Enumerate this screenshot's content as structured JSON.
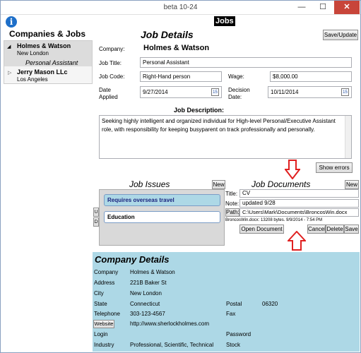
{
  "window": {
    "title": "beta 10-24",
    "min": "—",
    "max": "☐",
    "close": "✕"
  },
  "header": {
    "jobs_title": "Jobs",
    "info_icon": "i"
  },
  "companies": {
    "title": "Companies & Jobs",
    "items": [
      {
        "name": "Holmes & Watson",
        "city": "New London",
        "job": "Personal Assistant"
      },
      {
        "name": "Jerry Mason LLc",
        "city": "Los Angeles"
      }
    ]
  },
  "job_details": {
    "title": "Job Details",
    "save_label": "Save/Update",
    "company_label": "Company:",
    "company_value": "Holmes & Watson",
    "job_title_label": "Job Title:",
    "job_title_value": "Personal Assistant",
    "job_code_label": "Job Code:",
    "job_code_value": "Right-Hand person",
    "wage_label": "Wage:",
    "wage_value": "$8,000.00",
    "date_applied_label_1": "Date",
    "date_applied_label_2": "Applied",
    "date_applied_value": "9/27/2014",
    "decision_label_1": "Decision",
    "decision_label_2": "Date:",
    "decision_value": "10/11/2014",
    "calendar_icon_text": "15",
    "description_label": "Job Description:",
    "description": "Seeking highly intelligent and organized individual for High-level Personal/Executive Assistant role, with responsibility for keeping busyparent on track professionally and personally.",
    "show_errors_label": "Show errors"
  },
  "job_issues": {
    "title": "Job Issues",
    "new_label": "New",
    "up_label": "U",
    "down_label": "D",
    "items": [
      "Requires overseas travel",
      "Education"
    ]
  },
  "job_documents": {
    "title": "Job Documents",
    "new_label": "New",
    "title_label": "Title:",
    "title_value": "CV",
    "note_label": "Note:",
    "note_value": "updated 9/28",
    "path_label": "Path:",
    "path_value": "C:\\Users\\Mark\\Documents\\BroncosWin.docx",
    "file_info": "BroncosWin.docx: 13208 bytes. 9/9/2014 - 7:54 PM",
    "open_label": "Open Document",
    "cancel_label": "Cancel",
    "delete_label": "Delete",
    "save_label": "Save"
  },
  "company_details": {
    "title": "Company Details",
    "company_label": "Company",
    "company_value": "Holmes & Watson",
    "address_label": "Address",
    "address_value": "221B Baker St",
    "city_label": "City",
    "city_value": "New London",
    "state_label": "State",
    "state_value": "Connecticut",
    "postal_label": "Postal",
    "postal_value": "06320",
    "telephone_label": "Telephone",
    "telephone_value": "303-123-4567",
    "fax_label": "Fax",
    "website_label": "Website",
    "website_value": "http://www.sherlockholmes.com",
    "login_label": "Login",
    "password_label": "Password",
    "industry_label": "Industry",
    "industry_value": "Professional, Scientific, Technical",
    "stock_label": "Stock"
  },
  "colors": {
    "company_bg": "#add8e6",
    "accent_red": "#e02020",
    "selected_issue": "#add8e6"
  }
}
